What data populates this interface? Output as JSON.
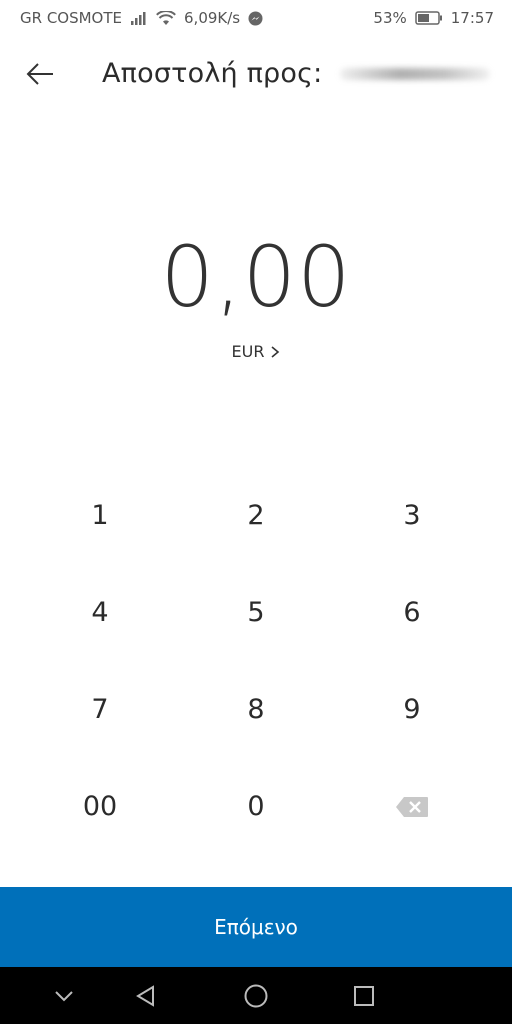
{
  "status_bar": {
    "carrier": "GR COSMOTE",
    "speed": "6,09K/s",
    "battery": "53%",
    "time": "17:57"
  },
  "header": {
    "title": "Αποστολή προς:"
  },
  "amount": {
    "value": "0,00",
    "currency": "EUR"
  },
  "keypad": {
    "keys": [
      "1",
      "2",
      "3",
      "4",
      "5",
      "6",
      "7",
      "8",
      "9",
      "00",
      "0"
    ]
  },
  "next_button": {
    "label": "Επόμενο"
  },
  "colors": {
    "primary": "#0070ba",
    "text": "#2b2b2b",
    "nav_bar": "#000000"
  }
}
